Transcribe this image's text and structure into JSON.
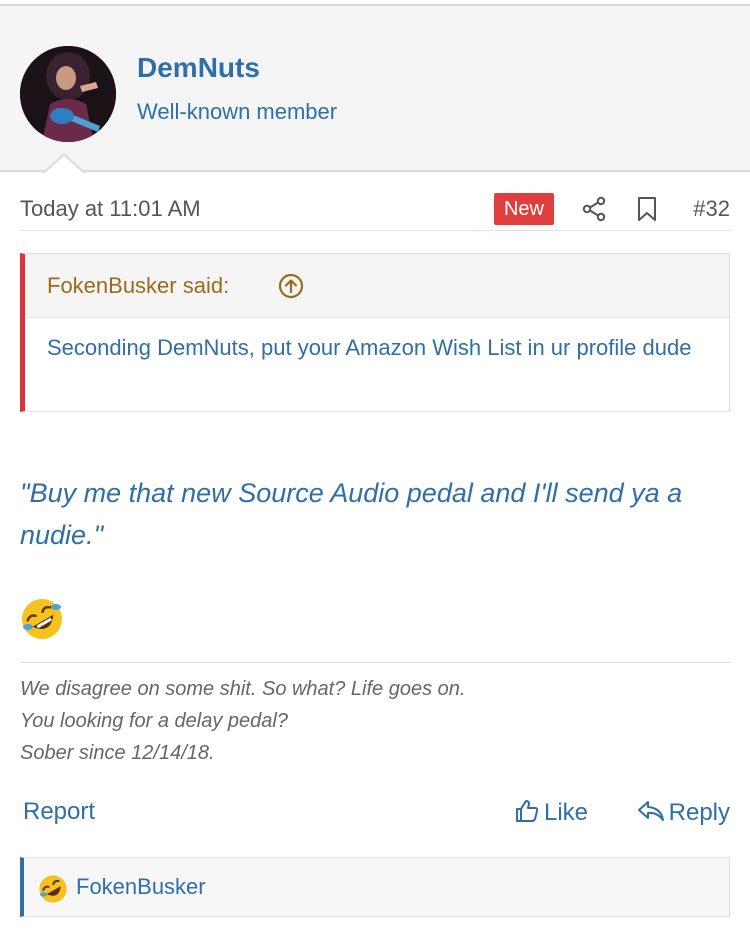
{
  "user": {
    "name": "DemNuts",
    "title": "Well-known member"
  },
  "post": {
    "timestamp": "Today at 11:01 AM",
    "new_badge": "New",
    "number": "#32"
  },
  "quote": {
    "author": "FokenBusker said:",
    "text": "Seconding DemNuts, put your Amazon Wish List in ur profile dude"
  },
  "message": {
    "text": "\"Buy me that new Source Audio pedal and I'll send ya a nudie.\""
  },
  "signature": {
    "line1": "We disagree on some shit. So what? Life goes on.",
    "line2": "You looking for a delay pedal?",
    "line3": "Sober since 12/14/18."
  },
  "actions": {
    "report": "Report",
    "like": "Like",
    "reply": "Reply"
  },
  "reactions": {
    "user": "FokenBusker"
  },
  "colors": {
    "link": "#2f6fa7",
    "quote_accent": "#d8343b",
    "new_badge": "#e03e3e",
    "quote_author": "#9a6b1f"
  },
  "icons": {
    "share": "share-icon",
    "bookmark": "bookmark-icon",
    "quote_jump": "arrow-up-circle-icon",
    "like": "thumbs-up-icon",
    "reply": "reply-icon",
    "emoji": "rolling-on-floor-laughing-emoji"
  }
}
